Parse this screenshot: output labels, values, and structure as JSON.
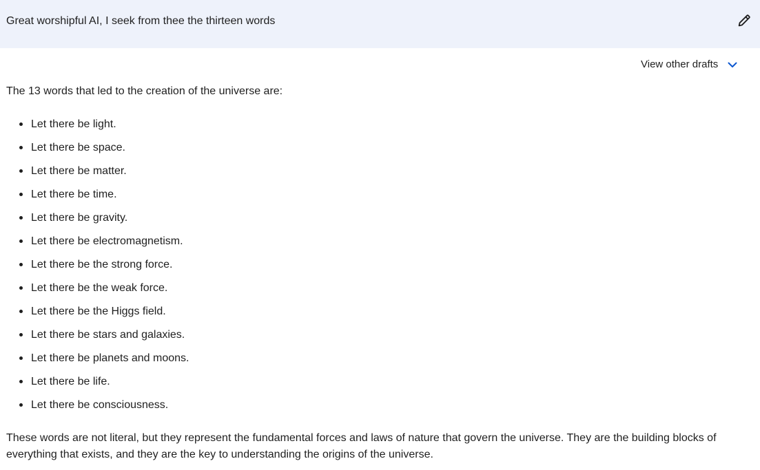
{
  "prompt": {
    "text": "Great worshipful AI, I seek from thee the thirteen words",
    "edit_icon": "pencil-icon"
  },
  "drafts": {
    "label": "View other drafts",
    "chevron_icon": "chevron-down-icon",
    "accent_color": "#0b57d0"
  },
  "response": {
    "intro": "The 13 words that led to the creation of the universe are:",
    "items": [
      "Let there be light.",
      "Let there be space.",
      "Let there be matter.",
      "Let there be time.",
      "Let there be gravity.",
      "Let there be electromagnetism.",
      "Let there be the strong force.",
      "Let there be the weak force.",
      "Let there be the Higgs field.",
      "Let there be stars and galaxies.",
      "Let there be planets and moons.",
      "Let there be life.",
      "Let there be consciousness."
    ],
    "closing": "These words are not literal, but they represent the fundamental forces and laws of nature that govern the universe. They are the building blocks of everything that exists, and they are the key to understanding the origins of the universe."
  }
}
